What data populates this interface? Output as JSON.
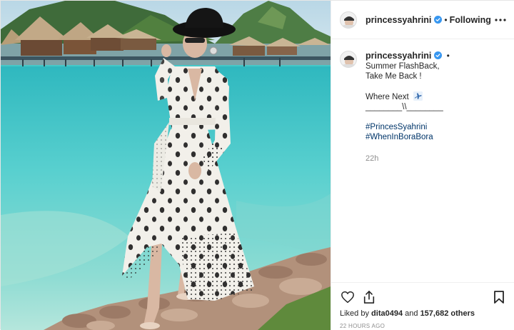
{
  "post": {
    "author": {
      "username": "princessyahrini",
      "verified": true,
      "follow_status": "Following",
      "separator": "•"
    },
    "caption": {
      "lines": [
        "Summer FlashBack,",
        "Take Me Back !"
      ],
      "where_next": "Where Next",
      "divider": "________\\\\________",
      "hashtags": [
        "#PrincesSyahrini",
        "#WhenInBoraBora"
      ],
      "relative_time": "22h"
    },
    "likes": {
      "prefix": "Liked by",
      "user": "dita0494",
      "joiner": "and",
      "others": "157,682 others"
    },
    "posted_ago": "22 HOURS AGO"
  },
  "icons": {
    "more": "more-options-icon",
    "verified": "verified-badge-icon",
    "airplane": "airplane-emoji-icon",
    "like": "heart-icon",
    "share": "share-icon",
    "save": "bookmark-icon"
  },
  "colors": {
    "verified_blue": "#3897f0",
    "hashtag": "#003569",
    "secondary_text": "#8e8e8e",
    "lagoon": "#45c9c9"
  }
}
